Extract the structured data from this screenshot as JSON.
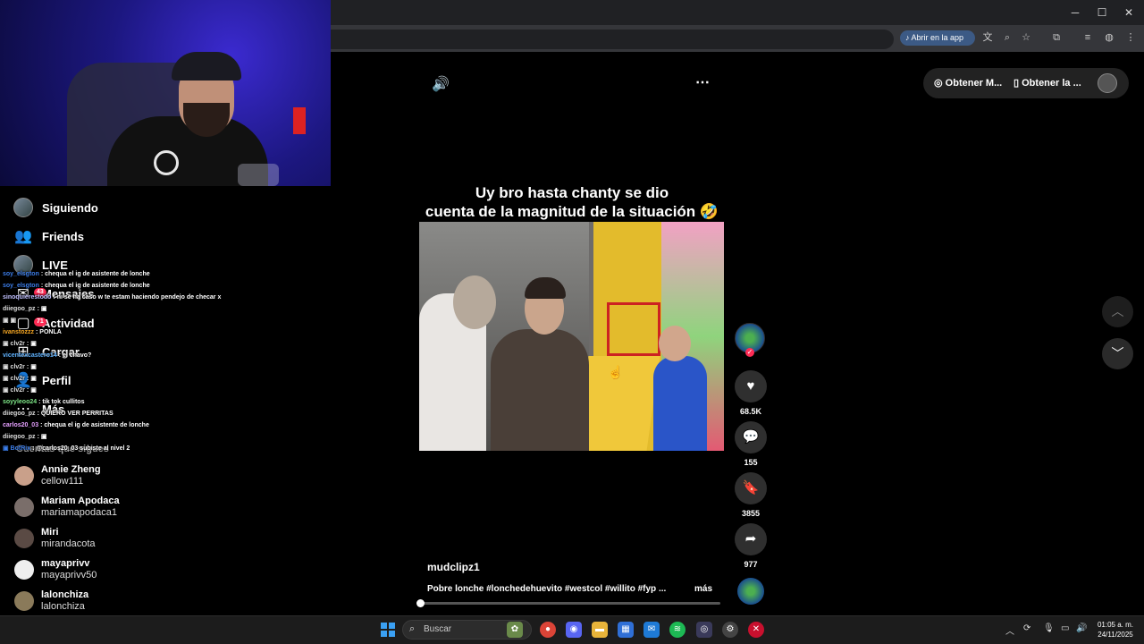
{
  "browser": {
    "open_in_app_label": "Abrir en la app",
    "window_controls": {
      "minimize": "─",
      "maximize": "☐",
      "close": "✕"
    }
  },
  "sidebar": {
    "nav": [
      {
        "label": "Siguiendo",
        "icon": "following-avatar-icon"
      },
      {
        "label": "Friends",
        "icon": "friends-icon"
      },
      {
        "label": "LIVE",
        "icon": "live-icon"
      },
      {
        "label": "Mensajes",
        "icon": "messages-icon",
        "badge": "43"
      },
      {
        "label": "Actividad",
        "icon": "activity-icon",
        "badge": "71"
      },
      {
        "label": "Cargar",
        "icon": "upload-icon"
      },
      {
        "label": "Perfil",
        "icon": "profile-icon"
      },
      {
        "label": "Más",
        "icon": "more-icon"
      }
    ],
    "following_title": "Cuentas que sigues",
    "accounts": [
      {
        "display": "Annie Zheng",
        "user": "cellow111"
      },
      {
        "display": "Mariam Apodaca",
        "user": "mariamapodaca1"
      },
      {
        "display": "Miri",
        "user": "mirandacota"
      },
      {
        "display": "mayaprivv",
        "user": "mayaprivv50"
      },
      {
        "display": "lalonchiza",
        "user": "lalonchiza"
      }
    ]
  },
  "chat": [
    {
      "user": "soy_elsgton",
      "msg": ": chequa el ig de asistente de lonche",
      "color": "#3b7de9"
    },
    {
      "user": "soy_elsgton",
      "msg": ": chequa el ig de asistente de lonche",
      "color": "#3b7de9"
    },
    {
      "user": "sinoquierestodo",
      "msg": ": ni se ha caso w te estam haciendo pendejo de checar x",
      "color": "#c0c0ff"
    },
    {
      "user": "diiegoo_pz",
      "msg": ": ▣",
      "color": "#ddd"
    },
    {
      "user": "▣ ▣",
      "msg": "",
      "color": "#ddd"
    },
    {
      "user": "ivanstozzz",
      "msg": ": PONLA",
      "color": "#f5a623"
    },
    {
      "user": "▣ clv2r",
      "msg": ": ▣",
      "color": "#ddd"
    },
    {
      "user": "vicentexcastero14",
      "msg": ": el chavo?",
      "color": "#5fb2ff"
    },
    {
      "user": "▣ clv2r",
      "msg": ": ▣",
      "color": "#ddd"
    },
    {
      "user": "▣ clv2r",
      "msg": ": ▣",
      "color": "#ddd"
    },
    {
      "user": "▣ clv2r",
      "msg": ": ▣",
      "color": "#ddd"
    },
    {
      "user": "soyyleoo24",
      "msg": ": tik tok cullitos",
      "color": "#7ee787"
    },
    {
      "user": "diiegoo_pz",
      "msg": ": QUIERO VER PERRITAS",
      "color": "#ddd"
    },
    {
      "user": "carlos20_03",
      "msg": ": chequa el ig de asistente de lonche",
      "color": "#e6a0ff"
    },
    {
      "user": "diiegoo_pz",
      "msg": ": ▣",
      "color": "#ddd"
    },
    {
      "user": "▣ BotRix",
      "msg": ": @carlos20_03 subiste al nivel 2",
      "color": "#3b7de9"
    }
  ],
  "video": {
    "caption_line1": "Uy bro hasta chanty se dio",
    "caption_line2": "cuenta de la magnitud de la situación 🤣🤣",
    "author": "mudclipz1",
    "description": "Pobre lonche #lonchedehuevito #westcol #willito #fyp ...",
    "more_label": "más",
    "likes": "68.5K",
    "comments": "155",
    "saves": "3855",
    "shares": "977",
    "progress_fraction": 0.01
  },
  "top_right": {
    "btn1": "Obtener M...",
    "btn2": "Obtener la ..."
  },
  "taskbar": {
    "search_placeholder": "Buscar",
    "time": "01:05 a. m.",
    "date": "24/11/2025"
  }
}
